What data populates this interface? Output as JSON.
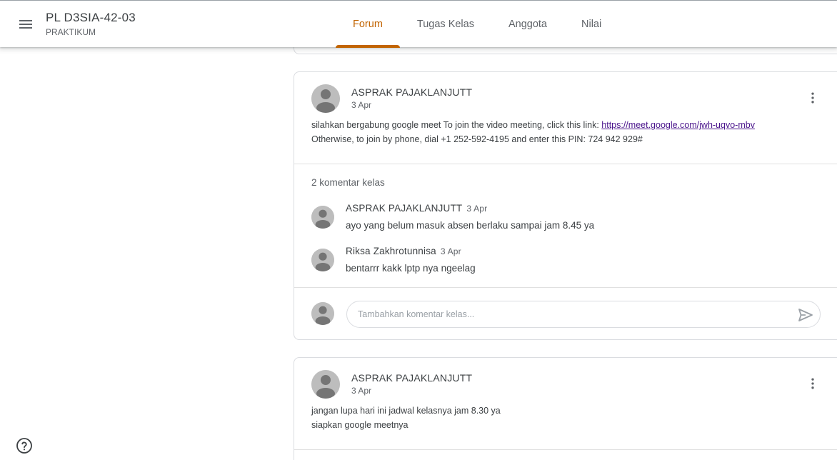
{
  "header": {
    "class_title": "PL D3SIA-42-03",
    "class_subtitle": "PRAKTIKUM",
    "tabs": [
      {
        "label": "Forum",
        "active": true
      },
      {
        "label": "Tugas Kelas",
        "active": false
      },
      {
        "label": "Anggota",
        "active": false
      },
      {
        "label": "Nilai",
        "active": false
      }
    ]
  },
  "colors": {
    "accent": "#c26401",
    "border": "#dadce0",
    "link": "#4a148c",
    "avatar_bg": "#bdbdbd"
  },
  "posts": [
    {
      "author": "ASPRAK PAJAKLANJUTT",
      "date": "3 Apr",
      "body_line1_prefix": "silahkan bergabung google meet To join the video meeting, click this link: ",
      "body_link": "https://meet.google.com/jwh-uqvo-mbv",
      "body_line2": "Otherwise, to join by phone, dial +1 252-592-4195 and enter this PIN: 724 942 929#",
      "comment_count": "2 komentar kelas",
      "comments": [
        {
          "author": "ASPRAK PAJAKLANJUTT",
          "date": "3 Apr",
          "text": "ayo yang belum masuk absen berlaku sampai jam 8.45 ya"
        },
        {
          "author": "Riksa Zakhrotunnisa",
          "date": "3 Apr",
          "text": "bentarrr kakk lptp nya ngeelag"
        }
      ],
      "comment_placeholder": "Tambahkan komentar kelas..."
    },
    {
      "author": "ASPRAK PAJAKLANJUTT",
      "date": "3 Apr",
      "body_line1": "jangan lupa hari ini jadwal kelasnya jam 8.30 ya",
      "body_line2": "siapkan google meetnya"
    }
  ],
  "icons": {
    "menu": "menu-icon",
    "more": "more-vert-icon",
    "send": "send-icon",
    "help": "help-icon",
    "avatar": "account-icon"
  }
}
